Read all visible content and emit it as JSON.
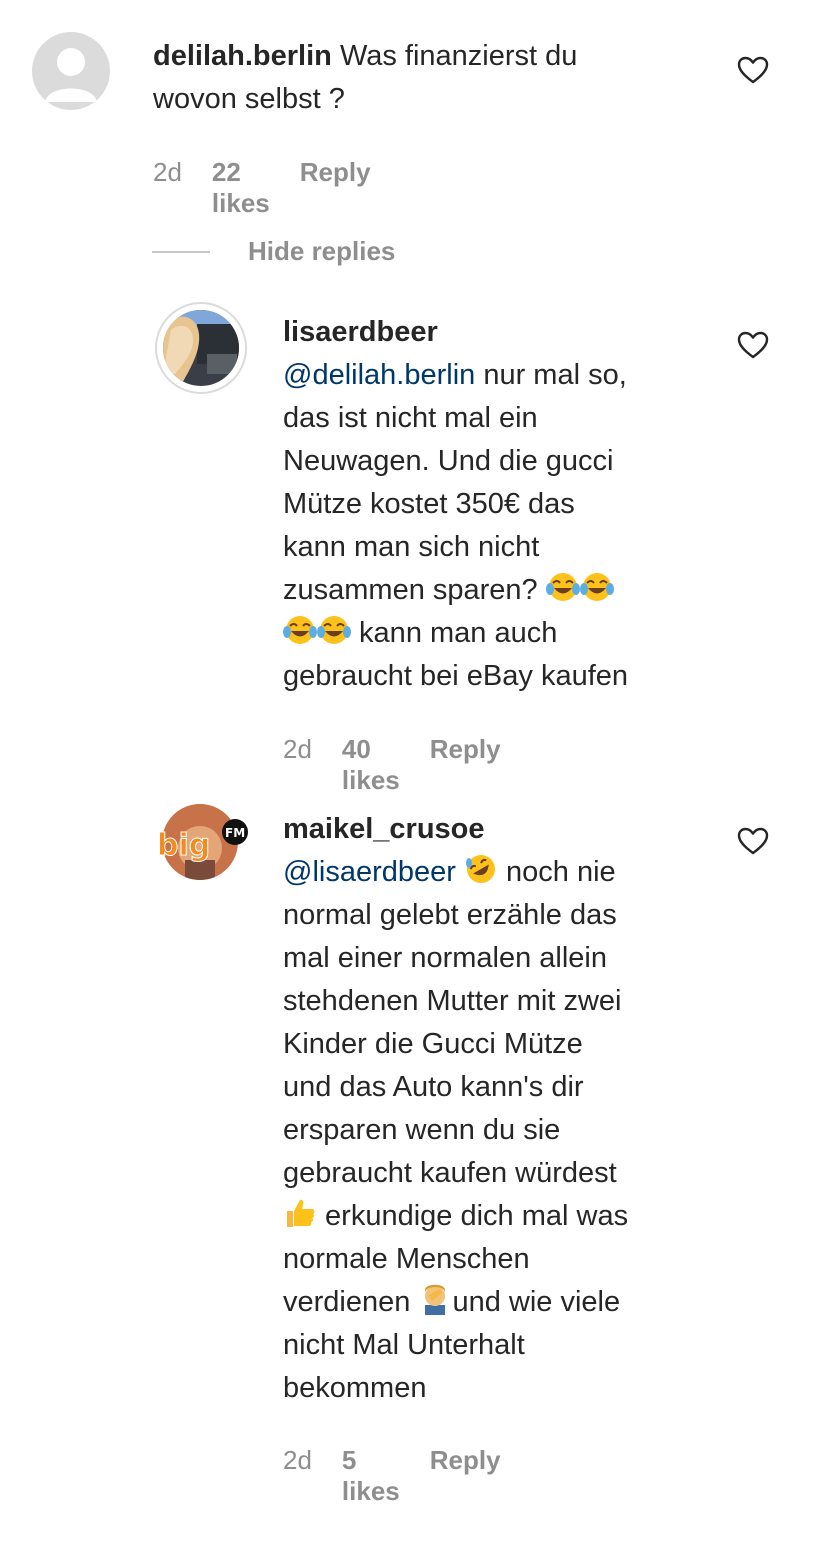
{
  "comments": [
    {
      "username": "delilah.berlin",
      "text_line1": "Was finanzierst du",
      "text_line2": "wovon selbst ?",
      "time": "2d",
      "likes": "22 likes",
      "reply": "Reply"
    },
    {
      "username": "lisaerdbeer",
      "mention": "@delilah.berlin",
      "lines": [
        " nur mal so,",
        "das ist nicht mal ein",
        "Neuwagen. Und die gucci",
        "Mütze kostet 350€ das",
        "kann man sich nicht",
        "zusammen sparen? ",
        " kann man auch",
        "gebraucht bei eBay kaufen"
      ],
      "time": "2d",
      "likes": "40 likes",
      "reply": "Reply"
    },
    {
      "username": "maikel_crusoe",
      "mention": "@lisaerdbeer",
      "lines": [
        " noch nie",
        "normal gelebt erzähle das",
        "mal einer normalen allein",
        "stehdenen Mutter mit zwei",
        "Kinder die Gucci Mütze",
        "und das Auto kann's dir",
        "ersparen wenn du sie",
        "gebraucht kaufen würdest",
        " erkundige dich mal was",
        "normale Menschen",
        "verdienen ",
        "und wie viele",
        "nicht Mal Unterhalt",
        "bekommen"
      ],
      "time": "2d",
      "likes": "5 likes",
      "reply": "Reply"
    }
  ],
  "hide_replies": "Hide replies",
  "avatar_badge": "big",
  "avatar_badge_fm": "FM",
  "icons": {
    "heart": "heart-outline-icon",
    "laugh": "tears-of-joy-emoji",
    "rofl": "rolling-on-floor-laughing-emoji",
    "thumbs": "thumbs-up-emoji",
    "facepalm": "facepalm-emoji"
  },
  "colors": {
    "text": "#262626",
    "secondary": "#8e8e8e",
    "mention": "#00376b"
  }
}
